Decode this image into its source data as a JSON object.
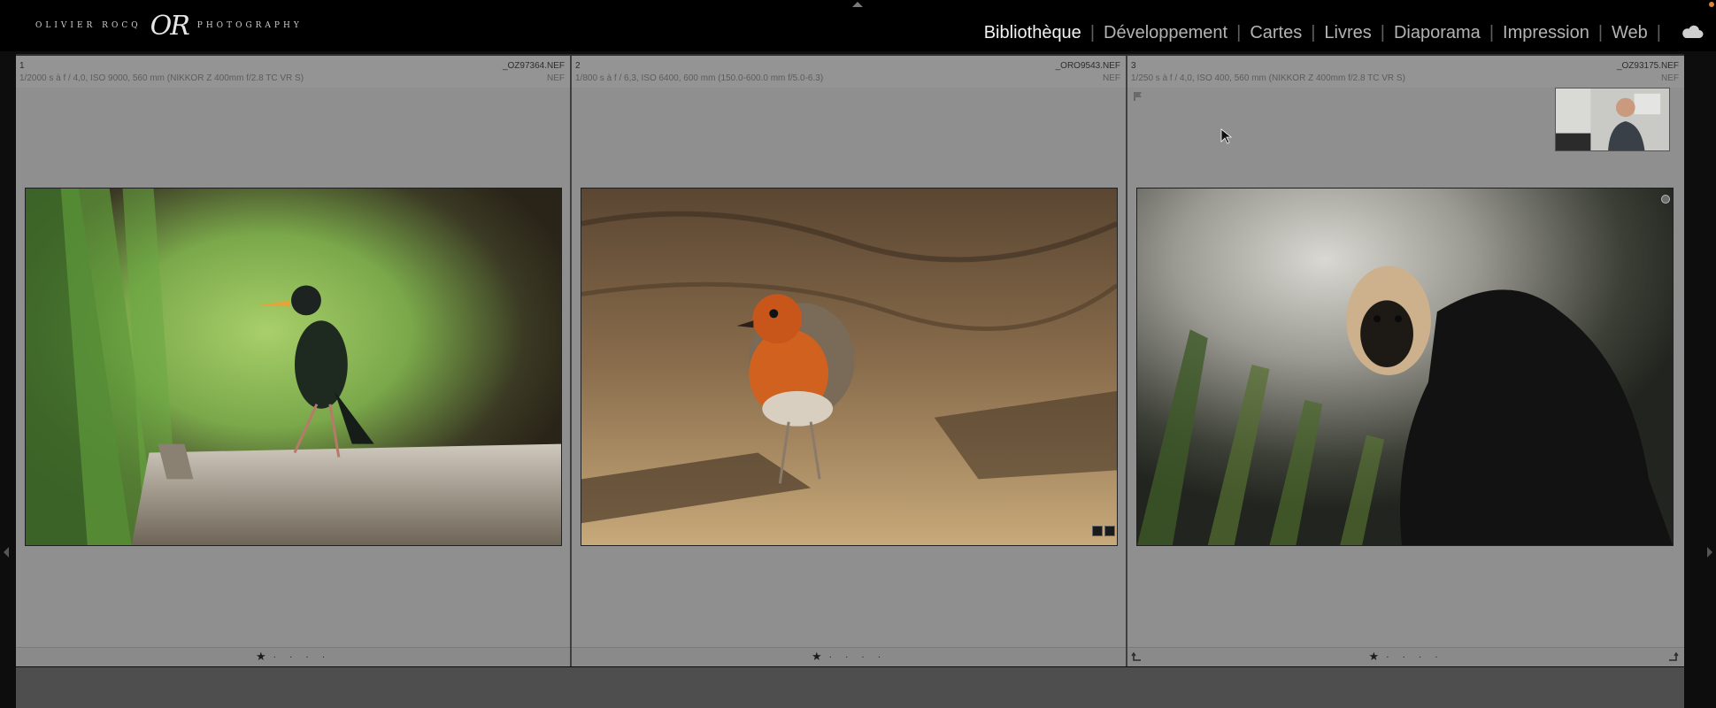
{
  "branding": {
    "left_text": "OLIVIER ROCQ",
    "monogram": "OR",
    "right_text": "PHOTOGRAPHY"
  },
  "modules": [
    {
      "label": "Bibliothèque",
      "active": true
    },
    {
      "label": "Développement",
      "active": false
    },
    {
      "label": "Cartes",
      "active": false
    },
    {
      "label": "Livres",
      "active": false
    },
    {
      "label": "Diaporama",
      "active": false
    },
    {
      "label": "Impression",
      "active": false
    },
    {
      "label": "Web",
      "active": false
    }
  ],
  "photos": [
    {
      "index": "1",
      "exif": "1/2000 s à f / 4,0, ISO 9000, 560 mm (NIKKOR Z 400mm f/2.8 TC VR S)",
      "filename": "_OZ97364.NEF",
      "filetype": "NEF",
      "subject": "starling on birch log",
      "rating": 1
    },
    {
      "index": "2",
      "exif": "1/800 s à f / 6,3, ISO 6400, 600 mm (150.0-600.0 mm f/5.0-6.3)",
      "filename": "_ORO9543.NEF",
      "filetype": "NEF",
      "subject": "robin on forest floor",
      "rating": 1
    },
    {
      "index": "3",
      "exif": "1/250 s à f / 4,0, ISO 400, 560 mm (NIKKOR Z 400mm f/2.8 TC VR S)",
      "filename": "_OZ93175.NEF",
      "filetype": "NEF",
      "subject": "white-faced saki monkey",
      "rating": 1
    }
  ],
  "rating_glyphs": {
    "star": "★",
    "dots": "· · · ·"
  },
  "icons": {
    "cloud": "cloud-icon",
    "flag": "flag-icon",
    "rotate_left": "rotate-left-icon",
    "rotate_right": "rotate-right-icon"
  },
  "colors": {
    "cell_bg": "#8f8f8f",
    "active_module": "#f2f2f2",
    "inactive_module": "#b3b3b3"
  }
}
